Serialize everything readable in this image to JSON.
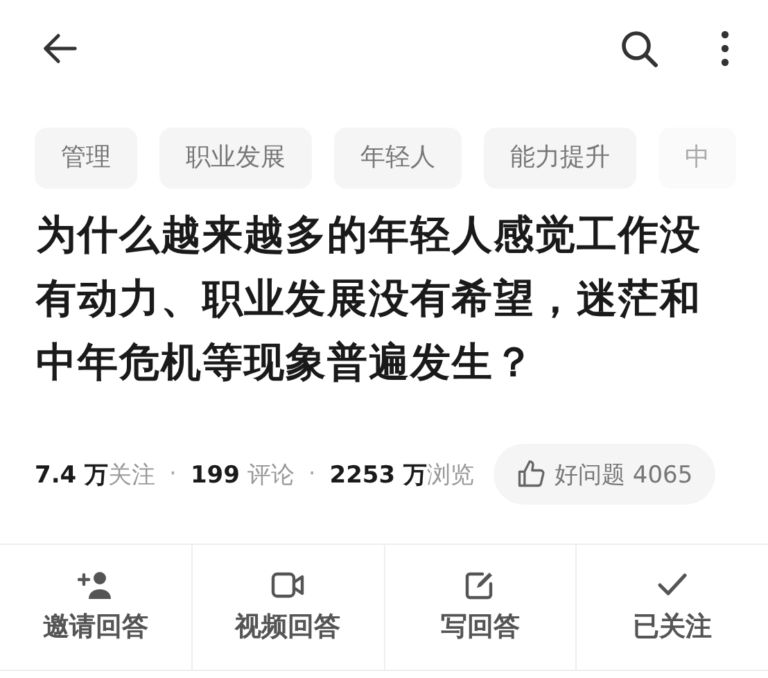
{
  "tags": [
    {
      "label": "管理",
      "faded": false
    },
    {
      "label": "职业发展",
      "faded": false
    },
    {
      "label": "年轻人",
      "faded": false
    },
    {
      "label": "能力提升",
      "faded": false
    },
    {
      "label": "中",
      "faded": true
    }
  ],
  "title": "为什么越来越多的年轻人感觉工作没有动力、职业发展没有希望，迷茫和中年危机等现象普遍发生？",
  "stats": [
    "**7.4 万**关注",
    "**199** 评论",
    "**2253 万**浏览"
  ],
  "separator": "·",
  "good_question": {
    "label": "好问题 4065"
  },
  "actions": [
    {
      "kind": "invite",
      "label": "邀请回答"
    },
    {
      "kind": "video",
      "label": "视频回答"
    },
    {
      "kind": "write",
      "label": "写回答"
    },
    {
      "kind": "followed",
      "label": "已关注"
    }
  ]
}
